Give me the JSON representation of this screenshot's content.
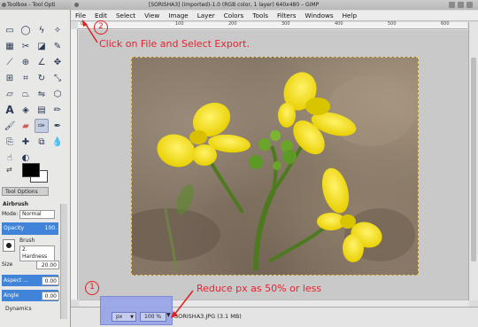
{
  "toolbox": {
    "title": "Toolbox - Tool Opti",
    "tool_options_tab": "Tool Options",
    "tool_name": "Airbrush",
    "mode_label": "Mode:",
    "mode_value": "Normal",
    "opacity_label": "Opacity",
    "opacity_value": "100.",
    "brush_label": "Brush",
    "brush_value": "2. Hardness",
    "size_label": "Size",
    "size_value": "20.00",
    "aspect_label": "Aspect ...",
    "aspect_value": "0.00",
    "angle_label": "Angle",
    "angle_value": "0.00",
    "dynamics_label": "Dynamics",
    "tools": [
      "rect-select",
      "ellipse-select",
      "free-select",
      "fuzzy-select",
      "color-select",
      "scissors",
      "foreground-select",
      "paths",
      "color-picker",
      "zoom",
      "measure",
      "move",
      "align",
      "crop",
      "rotate",
      "scale",
      "shear",
      "perspective",
      "flip",
      "cage",
      "text",
      "bucket-fill",
      "blend",
      "pencil",
      "paintbrush",
      "eraser",
      "airbrush",
      "ink",
      "clone",
      "heal",
      "perspective-clone",
      "blur",
      "smudge",
      "dodge-burn",
      "dodge",
      "burn"
    ]
  },
  "window": {
    "title": "[SORISHA3] (imported)-1.0 (RGB color, 1 layer) 640x480 – GIMP",
    "menu": [
      "File",
      "Edit",
      "Select",
      "View",
      "Image",
      "Layer",
      "Colors",
      "Tools",
      "Filters",
      "Windows",
      "Help"
    ],
    "ruler_labels": [
      "0",
      "100",
      "200",
      "300",
      "400",
      "500",
      "600"
    ]
  },
  "status": {
    "unit": "px",
    "zoom": "100 %",
    "filename": "SORISHA3.JPG (3.1 MB)"
  },
  "annotations": {
    "step2_number": "2",
    "step2_text": "Click on File and Select Export.",
    "step1_number": "1",
    "step1_text": "Reduce px as 50% or less"
  },
  "colors": {
    "annotation": "#e02020",
    "highlight": "#9aa6e8",
    "flower": "#f2e100"
  }
}
